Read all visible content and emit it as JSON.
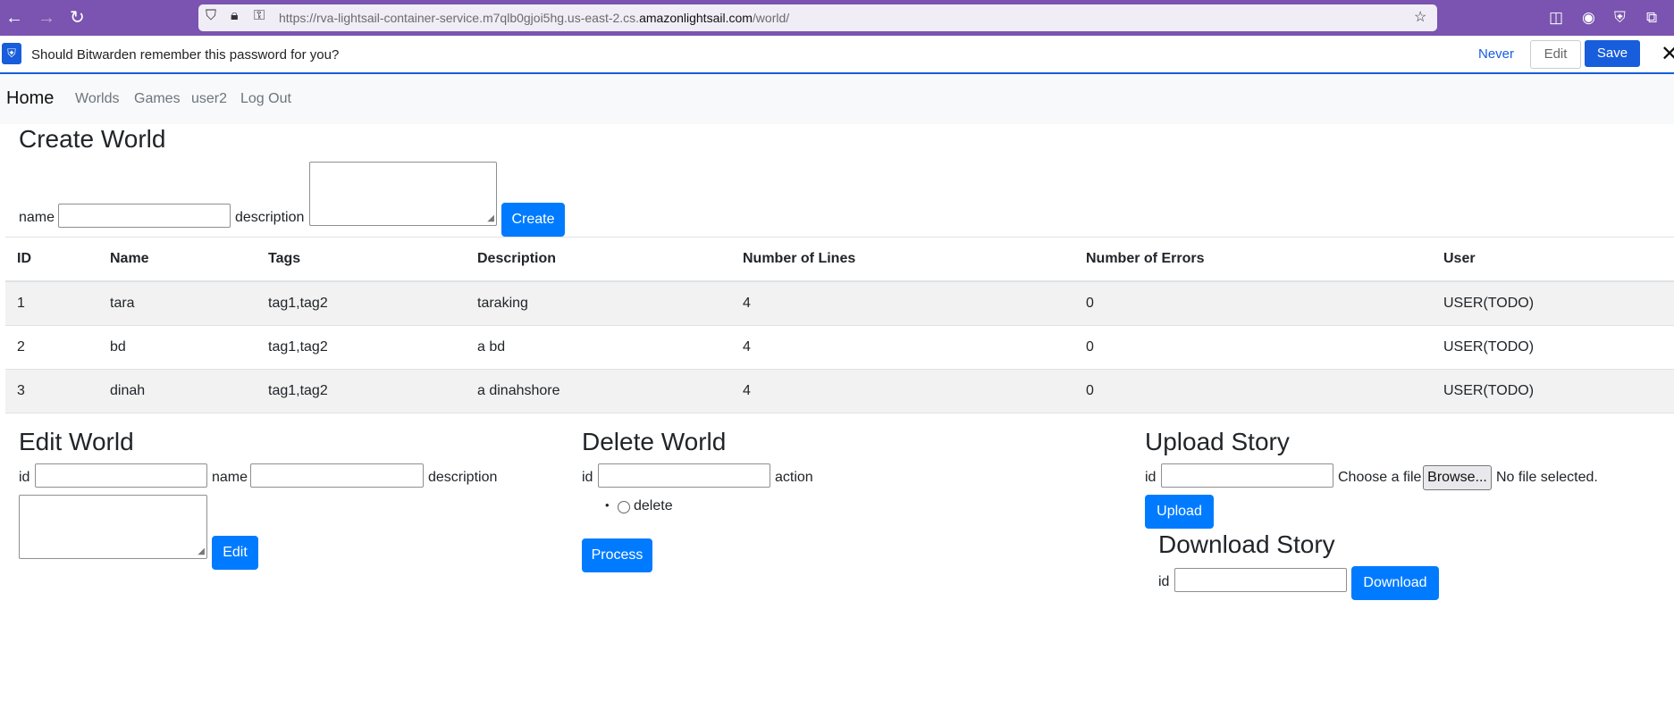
{
  "browser": {
    "url_prefix": "https://rva-lightsail-container-service.m7qlb0gjoi5hg.us-east-2.cs.",
    "url_domain": "amazonlightsail.com",
    "url_suffix": "/world/"
  },
  "bitwarden": {
    "message": "Should Bitwarden remember this password for you?",
    "never": "Never",
    "edit": "Edit",
    "save": "Save",
    "close": "✕"
  },
  "nav": {
    "brand": "Home",
    "links": [
      "Worlds",
      "Games",
      "user2",
      "Log Out"
    ]
  },
  "create": {
    "title": "Create World",
    "name_label": "name",
    "desc_label": "description",
    "button": "Create"
  },
  "table": {
    "headers": [
      "ID",
      "Name",
      "Tags",
      "Description",
      "Number of Lines",
      "Number of Errors",
      "User"
    ],
    "rows": [
      [
        "1",
        "tara",
        "tag1,tag2",
        "taraking",
        "4",
        "0",
        "USER(TODO)"
      ],
      [
        "2",
        "bd",
        "tag1,tag2",
        "a bd",
        "4",
        "0",
        "USER(TODO)"
      ],
      [
        "3",
        "dinah",
        "tag1,tag2",
        "a dinahshore",
        "4",
        "0",
        "USER(TODO)"
      ]
    ]
  },
  "edit": {
    "title": "Edit World",
    "id_label": "id",
    "name_label": "name",
    "desc_label": "description",
    "button": "Edit"
  },
  "delete": {
    "title": "Delete World",
    "id_label": "id",
    "action_label": "action",
    "option": "delete",
    "button": "Process"
  },
  "upload": {
    "title": "Upload Story",
    "id_label": "id",
    "choose_label": "Choose a file",
    "browse": "Browse...",
    "no_file": "No file selected.",
    "button": "Upload"
  },
  "download": {
    "title": "Download Story",
    "id_label": "id",
    "button": "Download"
  }
}
